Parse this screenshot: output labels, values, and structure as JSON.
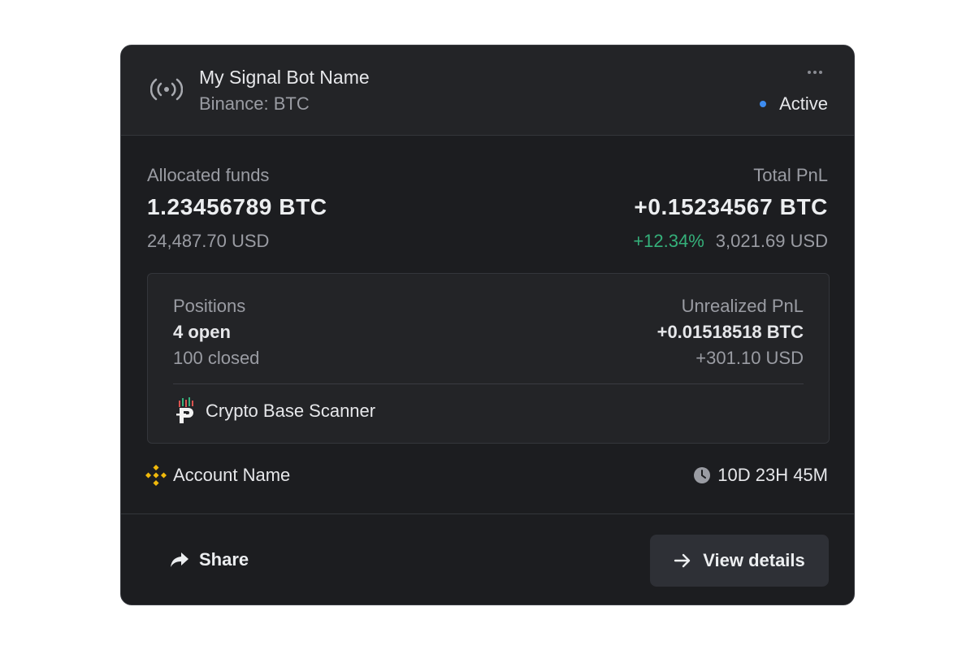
{
  "bot": {
    "name": "My Signal Bot Name",
    "exchange_pair": "Binance: BTC",
    "status": "Active",
    "status_color": "#3d8cf0",
    "icon": "signal-broadcast-icon",
    "menu_icon": "more-horizontal-icon"
  },
  "allocated": {
    "label": "Allocated funds",
    "value": "1.23456789 BTC",
    "usd": "24,487.70 USD"
  },
  "total_pnl": {
    "label": "Total PnL",
    "value": "+0.15234567 BTC",
    "percent": "+12.34%",
    "percent_color": "#35b07a",
    "usd": "3,021.69 USD"
  },
  "positions": {
    "label": "Positions",
    "open": "4 open",
    "closed": "100 closed"
  },
  "unrealized_pnl": {
    "label": "Unrealized PnL",
    "btc": "+0.01518518 BTC",
    "usd": "+301.10 USD"
  },
  "signal_source": {
    "name": "Crypto Base Scanner",
    "icon": "crypto-base-scanner-logo"
  },
  "account": {
    "name": "Account Name",
    "icon": "binance-icon",
    "brand_color": "#f0b90b"
  },
  "runtime": {
    "value": "10D 23H 45M",
    "icon": "clock-icon"
  },
  "footer": {
    "share_label": "Share",
    "share_icon": "share-arrow-icon",
    "view_label": "View details",
    "view_icon": "arrow-right-icon"
  }
}
